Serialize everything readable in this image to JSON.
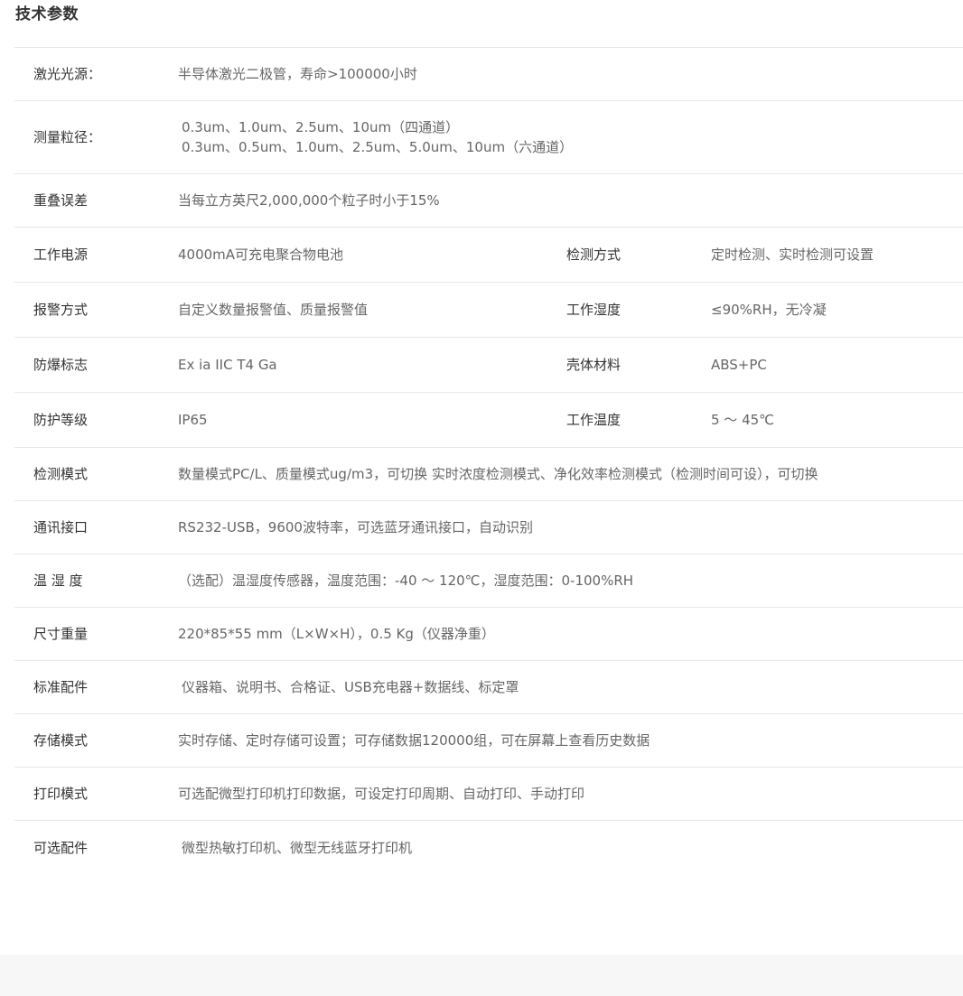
{
  "section_title": "技术参数",
  "rows": [
    {
      "label": "激光光源：",
      "value": "半导体激光二极管，寿命>100000小时"
    },
    {
      "label": "测量粒径：",
      "value_lines": [
        "0.3um、1.0um、2.5um、10um（四通道）",
        "0.3um、0.5um、1.0um、2.5um、5.0um、10um（六通道）"
      ]
    },
    {
      "label": "重叠误差",
      "value": "当每立方英尺2,000,000个粒子时小于15%"
    },
    {
      "label": "工作电源",
      "value": "4000mA可充电聚合物电池",
      "label2": "检测方式",
      "value2": "定时检测、实时检测可设置"
    },
    {
      "label": "报警方式",
      "value": "自定义数量报警值、质量报警值",
      "label2": "工作湿度",
      "value2": "≤90%RH，无冷凝"
    },
    {
      "label": "防爆标志",
      "value": "Ex ia IIC T4 Ga",
      "label2": "壳体材料",
      "value2": "ABS+PC"
    },
    {
      "label": "防护等级",
      "value": "IP65",
      "label2": "工作温度",
      "value2": "5 ～ 45℃"
    },
    {
      "label": "检测模式",
      "value": "数量模式PC/L、质量模式ug/m3，可切换 实时浓度检测模式、净化效率检测模式（检测时间可设），可切换"
    },
    {
      "label": "通讯接口",
      "value": "RS232-USB，9600波特率，可选蓝牙通讯接口，自动识别"
    },
    {
      "label": "温 湿 度",
      "value": "（选配）温湿度传感器，温度范围：-40 ～ 120℃，湿度范围：0-100%RH"
    },
    {
      "label": "尺寸重量",
      "value": "220*85*55 mm（L×W×H），0.5 Kg（仪器净重）"
    },
    {
      "label": "标准配件",
      "value": "仪器箱、说明书、合格证、USB充电器+数据线、标定罩"
    },
    {
      "label": "存储模式",
      "value": "实时存储、定时存储可设置；可存储数据120000组，可在屏幕上查看历史数据"
    },
    {
      "label": "打印模式",
      "value": "可选配微型打印机打印数据，可设定打印周期、自动打印、手动打印"
    },
    {
      "label": "可选配件",
      "value": "微型热敏打印机、微型无线蓝牙打印机"
    }
  ]
}
